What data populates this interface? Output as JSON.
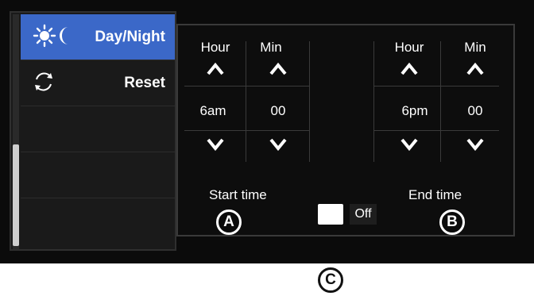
{
  "sidebar": {
    "items": [
      {
        "label": "Day/Night",
        "icon": "sun-moon-icon",
        "active": true
      },
      {
        "label": "Reset",
        "icon": "refresh-icon",
        "active": false
      },
      {
        "label": "",
        "active": false
      },
      {
        "label": "",
        "active": false
      },
      {
        "label": "",
        "active": false
      }
    ]
  },
  "start": {
    "hour_label": "Hour",
    "min_label": "Min",
    "hour_value": "6am",
    "min_value": "00",
    "caption": "Start time",
    "marker": "A"
  },
  "end": {
    "hour_label": "Hour",
    "min_label": "Min",
    "hour_value": "6pm",
    "min_value": "00",
    "caption": "End time",
    "marker": "B"
  },
  "toggle": {
    "state_label": "Off",
    "marker": "C"
  },
  "colors": {
    "accent": "#3b68c8",
    "background": "#0b0b0b",
    "text": "#ffffff"
  }
}
